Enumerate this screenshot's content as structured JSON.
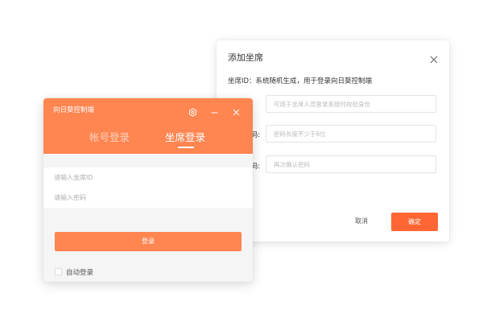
{
  "dialog": {
    "title": "添加坐席",
    "info": "坐席ID：系统随机生成，用于登录向日葵控制端",
    "fields": [
      {
        "label": "",
        "placeholder": "可用于坐席人员登录系统时校验身份"
      },
      {
        "label": "码:",
        "placeholder": "密码长度不少于6位"
      },
      {
        "label": "码:",
        "placeholder": "再次确认密码"
      }
    ],
    "cancel_label": "取消",
    "confirm_label": "确定"
  },
  "login": {
    "title": "向日葵控制端",
    "tabs": [
      {
        "label": "帐号登录",
        "active": false
      },
      {
        "label": "坐席登录",
        "active": true
      }
    ],
    "seat_id_placeholder": "请输入坐席ID",
    "password_placeholder": "请输入密码",
    "login_label": "登录",
    "auto_login_label": "自动登录",
    "auto_login_checked": false
  },
  "icons": {
    "settings": "gear-icon",
    "minimize": "minimize-icon",
    "close": "close-icon",
    "dialog_close": "close-icon"
  },
  "colors": {
    "accent": "#ff8551",
    "confirm": "#ff6633",
    "muted_panel": "#f5f5f5"
  }
}
